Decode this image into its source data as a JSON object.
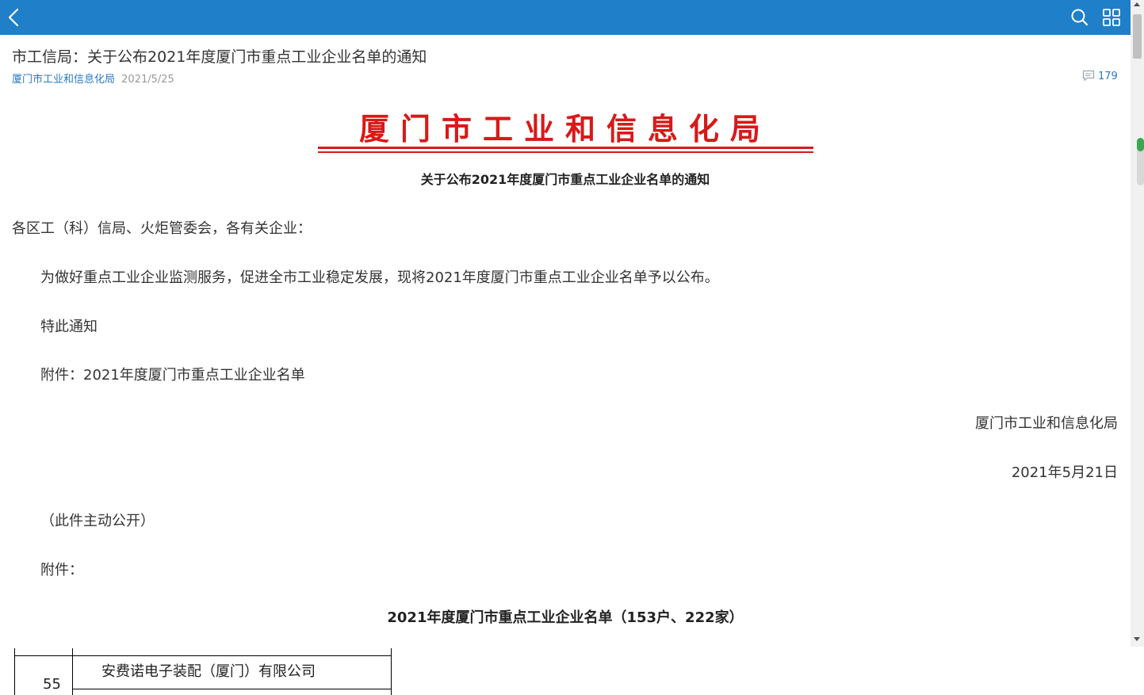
{
  "header": {
    "back_icon": "chevron-left-icon",
    "search_icon": "search-icon",
    "grid_icon": "grid-icon",
    "bar_color": "#1f7fc8"
  },
  "article": {
    "title": "市工信局：关于公布2021年度厦门市重点工业企业名单的通知",
    "source": "厦门市工业和信息化局",
    "date": "2021/5/25",
    "comment_count": "179"
  },
  "document": {
    "org_heading": "厦门市工业和信息化局",
    "notice_title": "关于公布2021年度厦门市重点工业企业名单的通知",
    "addressee": "各区工（科）信局、火炬管委会，各有关企业：",
    "body_paragraph": "为做好重点工业企业监测服务，促进全市工业稳定发展，现将2021年度厦门市重点工业企业名单予以公布。",
    "closing": "特此通知",
    "attachment_line": "附件：2021年度厦门市重点工业企业名单",
    "signature": "厦门市工业和信息化局",
    "sign_date": "2021年5月21日",
    "disclosure": "（此件主动公开）",
    "attachment_label": "附件：",
    "list_title": "2021年度厦门市重点工业企业名单（153户、222家）",
    "accent_color": "#d81919"
  },
  "table": {
    "rows": [
      {
        "number": "55",
        "company": "安费诺电子装配（厦门）有限公司"
      }
    ]
  },
  "scroll": {
    "reading_progress": 0.28
  }
}
